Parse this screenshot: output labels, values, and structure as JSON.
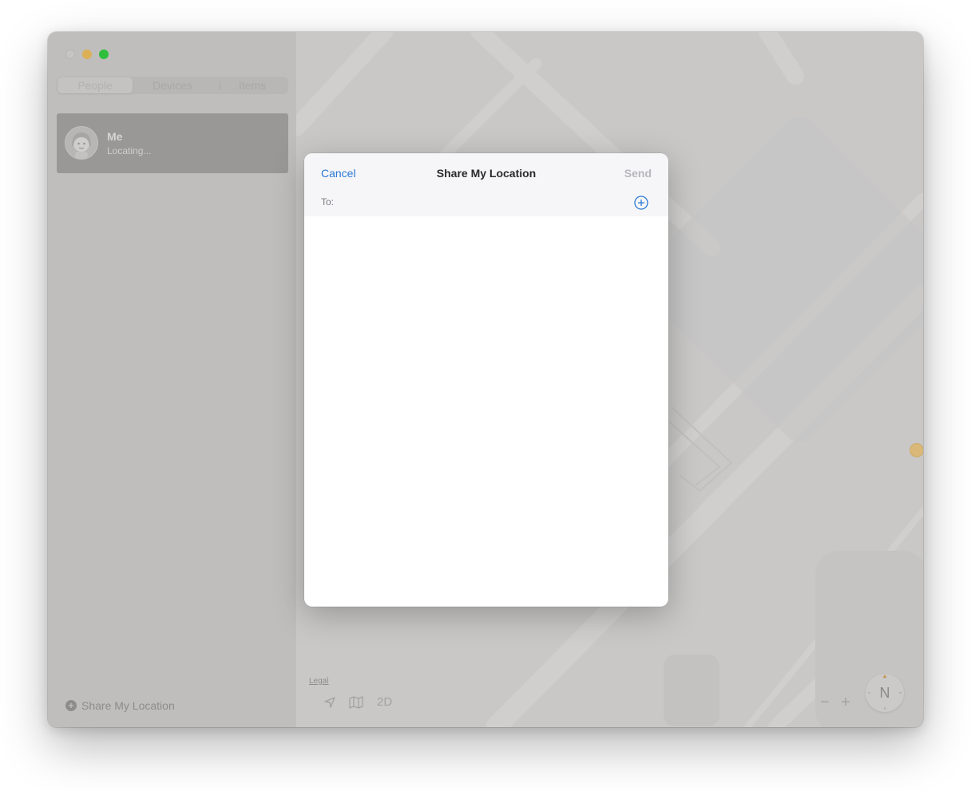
{
  "sidebar": {
    "tabs": [
      {
        "label": "People"
      },
      {
        "label": "Devices"
      },
      {
        "label": "Items"
      }
    ],
    "selected_tab": "People",
    "people": [
      {
        "name": "Me",
        "status": "Locating..."
      }
    ],
    "share_label": "Share My Location"
  },
  "map": {
    "legal_label": "Legal",
    "view_mode_label": "2D",
    "zoom_out_label": "−",
    "zoom_in_label": "+",
    "compass_label": "N"
  },
  "modal": {
    "title": "Share My Location",
    "cancel_label": "Cancel",
    "send_label": "Send",
    "to_label": "To:",
    "to_value": ""
  },
  "colors": {
    "accent": "#2b78d4",
    "close": "#c6c5c4",
    "minimize": "#dcb057",
    "maximize": "#2fbf3c"
  },
  "icons": [
    "location-arrow-icon",
    "map-icon",
    "add-recipient-icon",
    "add-circle-icon",
    "memoji-avatar-icon",
    "poi-marker-icon"
  ]
}
